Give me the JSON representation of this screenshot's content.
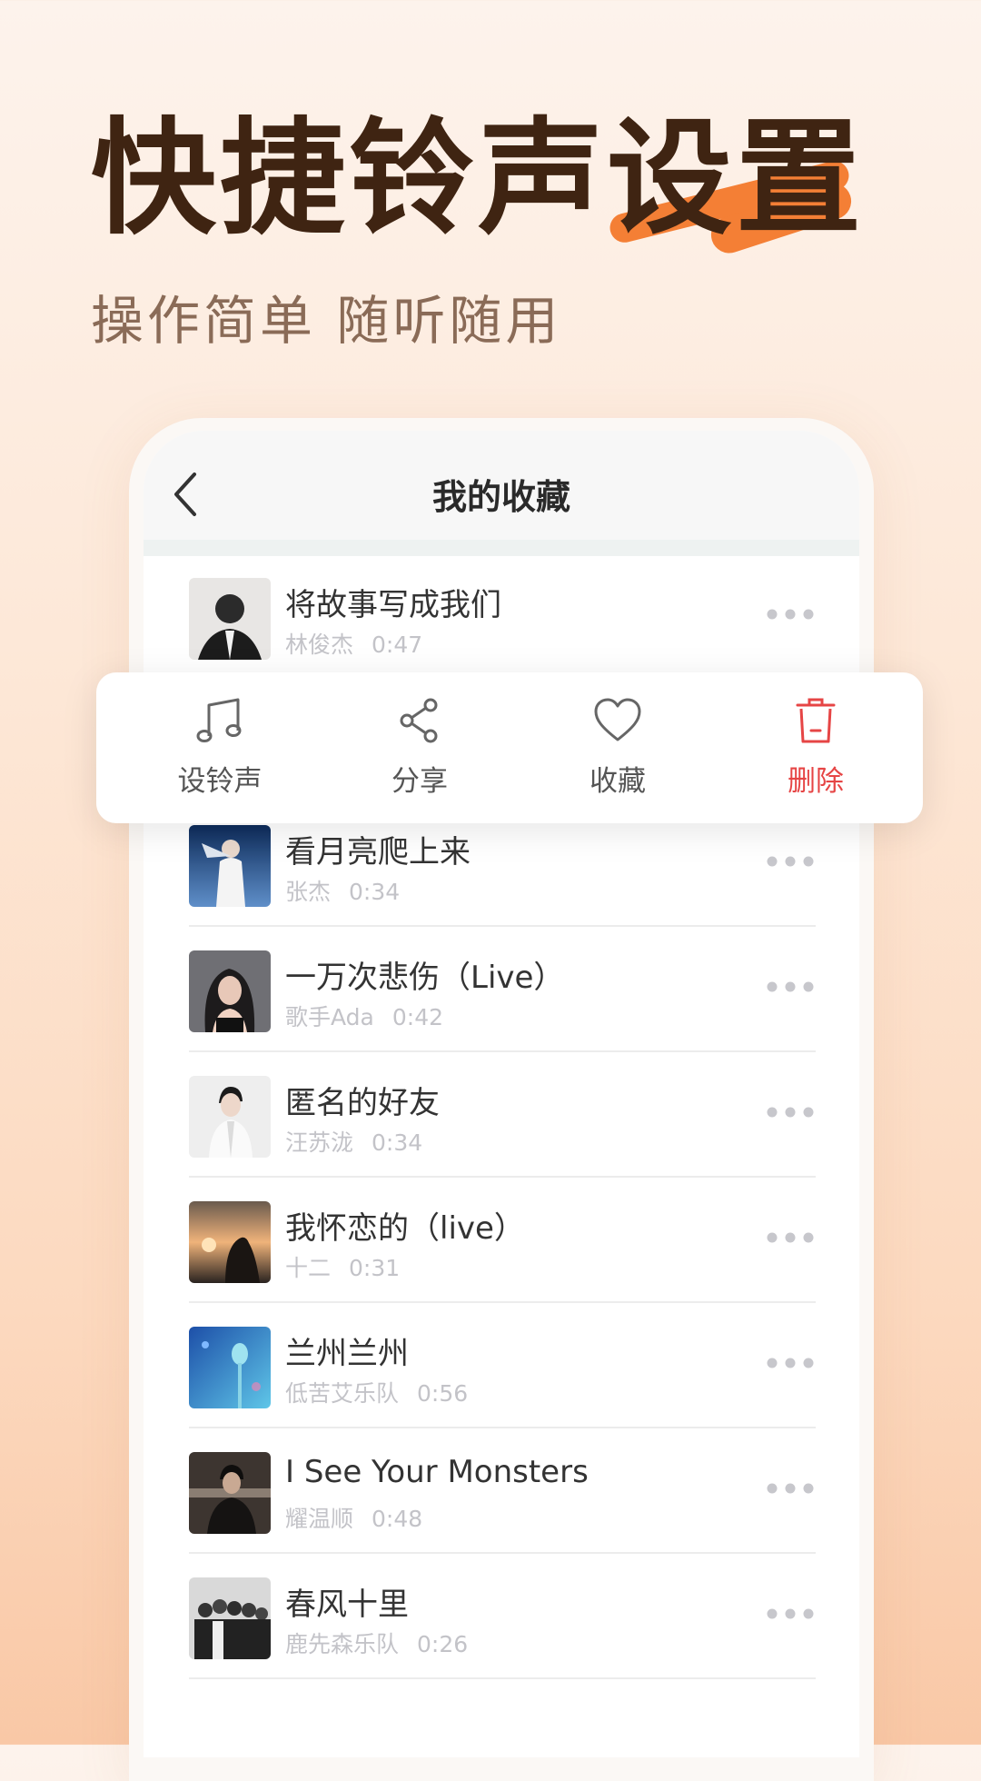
{
  "promo": {
    "headline": "快捷铃声设置",
    "subtitle": "操作简单 随听随用"
  },
  "header": {
    "title": "我的收藏"
  },
  "actions": [
    {
      "label": "设铃声",
      "icon": "music-note-icon"
    },
    {
      "label": "分享",
      "icon": "share-icon"
    },
    {
      "label": "收藏",
      "icon": "heart-icon"
    },
    {
      "label": "删除",
      "icon": "trash-icon"
    }
  ],
  "songs": [
    {
      "title": "将故事写成我们",
      "artist": "林俊杰",
      "duration": "0:47"
    },
    {
      "title": "看月亮爬上来",
      "artist": "张杰",
      "duration": "0:34"
    },
    {
      "title": "一万次悲伤（Live）",
      "artist": "歌手Ada",
      "duration": "0:42"
    },
    {
      "title": "匿名的好友",
      "artist": "汪苏泷",
      "duration": "0:34"
    },
    {
      "title": "我怀恋的（live）",
      "artist": "十二",
      "duration": "0:31"
    },
    {
      "title": "兰州兰州",
      "artist": "低苦艾乐队",
      "duration": "0:56"
    },
    {
      "title": "I See Your Monsters",
      "artist": "耀温顺",
      "duration": "0:48"
    },
    {
      "title": "春风十里",
      "artist": "鹿先森乐队",
      "duration": "0:26"
    }
  ],
  "colors": {
    "accent_orange": "#f47f35",
    "headline_brown": "#3f2412",
    "delete_red": "#e64545"
  }
}
